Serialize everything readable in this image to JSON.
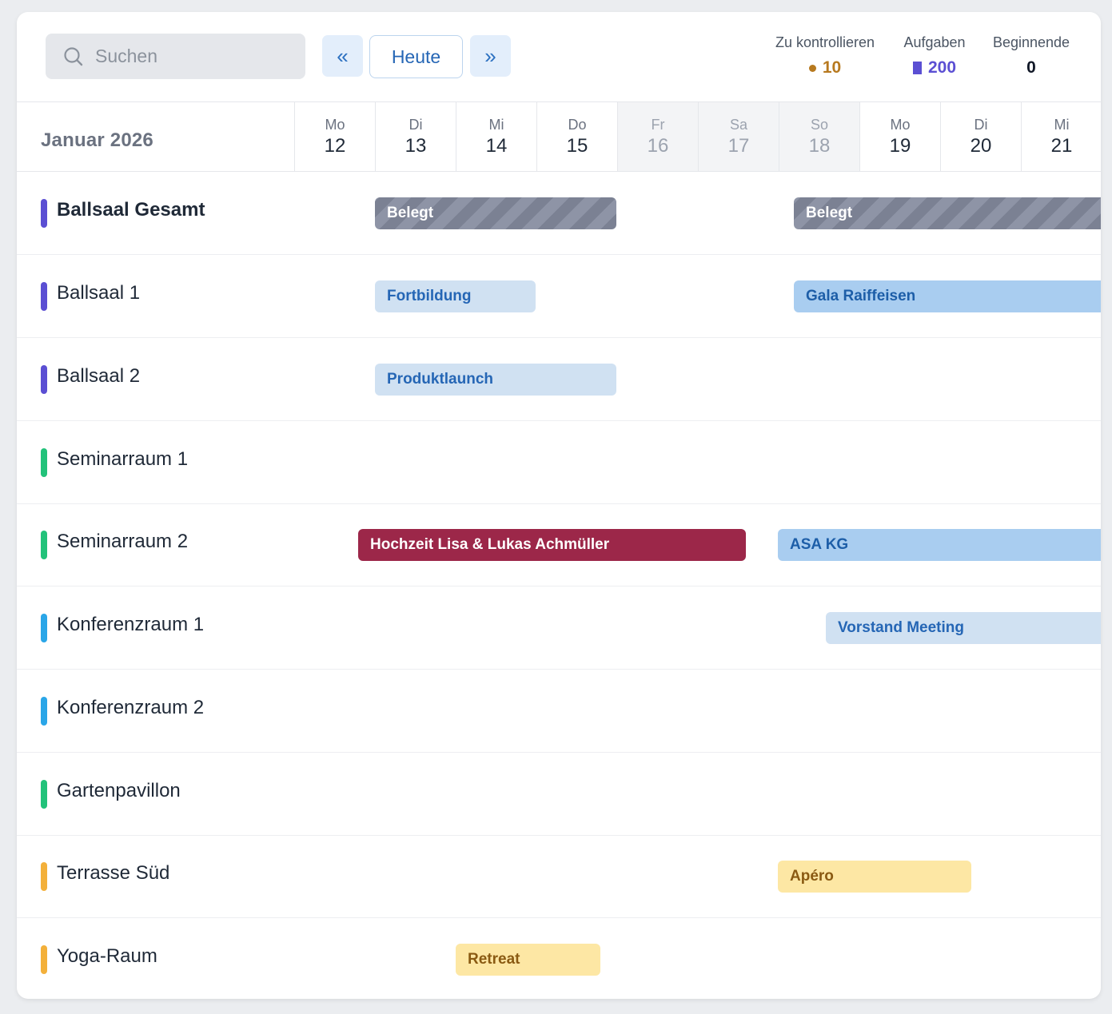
{
  "search": {
    "placeholder": "Suchen",
    "value": ""
  },
  "nav": {
    "prev_icon": "«",
    "today_label": "Heute",
    "next_icon": "»"
  },
  "stats": [
    {
      "label": "Zu kontrollieren",
      "value": "10",
      "color": "#b7791f",
      "marker": "dot"
    },
    {
      "label": "Aufgaben",
      "value": "200",
      "color": "#5b4fd3",
      "marker": "square"
    },
    {
      "label": "Beginnende",
      "value": "0",
      "color": "#111827",
      "marker": "none"
    }
  ],
  "calendar": {
    "month_label": "Januar 2026",
    "days": [
      {
        "name": "Mo",
        "date": "12",
        "weekend": false
      },
      {
        "name": "Di",
        "date": "13",
        "weekend": false
      },
      {
        "name": "Mi",
        "date": "14",
        "weekend": false
      },
      {
        "name": "Do",
        "date": "15",
        "weekend": false
      },
      {
        "name": "Fr",
        "date": "16",
        "weekend": true
      },
      {
        "name": "Sa",
        "date": "17",
        "weekend": true
      },
      {
        "name": "So",
        "date": "18",
        "weekend": true
      },
      {
        "name": "Mo",
        "date": "19",
        "weekend": false
      },
      {
        "name": "Di",
        "date": "20",
        "weekend": false
      },
      {
        "name": "Mi",
        "date": "21",
        "weekend": false
      }
    ]
  },
  "rooms": [
    {
      "name": "Ballsaal Gesamt",
      "color": "#5b4fd3",
      "bold": true
    },
    {
      "name": "Ballsaal 1",
      "color": "#5b4fd3",
      "bold": false
    },
    {
      "name": "Ballsaal 2",
      "color": "#5b4fd3",
      "bold": false
    },
    {
      "name": "Seminarraum 1",
      "color": "#22c27a",
      "bold": false
    },
    {
      "name": "Seminarraum 2",
      "color": "#22c27a",
      "bold": false
    },
    {
      "name": "Konferenzraum 1",
      "color": "#2aa6e8",
      "bold": false
    },
    {
      "name": "Konferenzraum 2",
      "color": "#2aa6e8",
      "bold": false
    },
    {
      "name": "Gartenpavillon",
      "color": "#22c27a",
      "bold": false
    },
    {
      "name": "Terrasse Süd",
      "color": "#f3b03a",
      "bold": false
    },
    {
      "name": "Yoga-Raum",
      "color": "#f3b03a",
      "bold": false
    }
  ],
  "events": [
    {
      "room": "Ballsaal Gesamt",
      "label": "Belegt",
      "style": "belegt"
    },
    {
      "room": "Ballsaal Gesamt",
      "label": "Belegt",
      "style": "belegt"
    },
    {
      "room": "Ballsaal 1",
      "label": "Fortbildung",
      "style": "lightblue"
    },
    {
      "room": "Ballsaal 1",
      "label": "Gala Raiffeisen",
      "style": "blue"
    },
    {
      "room": "Ballsaal 2",
      "label": "Produktlaunch",
      "style": "lightblue"
    },
    {
      "room": "Seminarraum 2",
      "label": "Hochzeit Lisa & Lukas Achmüller",
      "style": "red"
    },
    {
      "room": "Seminarraum 2",
      "label": "ASA KG",
      "style": "blue"
    },
    {
      "room": "Konferenzraum 1",
      "label": "Vorstand Meeting",
      "style": "lightblue"
    },
    {
      "room": "Terrasse Süd",
      "label": "Apéro",
      "style": "yellow"
    },
    {
      "room": "Yoga-Raum",
      "label": "Retreat",
      "style": "yellow"
    }
  ]
}
